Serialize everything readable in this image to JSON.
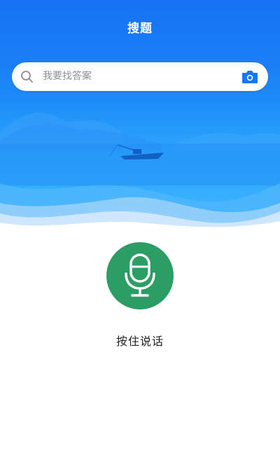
{
  "header": {
    "title": "搜题"
  },
  "search": {
    "placeholder": "我要找答案",
    "search_icon": "search-icon",
    "camera_icon": "camera-icon"
  },
  "voice": {
    "button_icon": "microphone-icon",
    "hold_label": "按住说话"
  },
  "colors": {
    "header_blue": "#1672f3",
    "mic_green": "#2d9d66",
    "camera_blue": "#1677f5"
  }
}
